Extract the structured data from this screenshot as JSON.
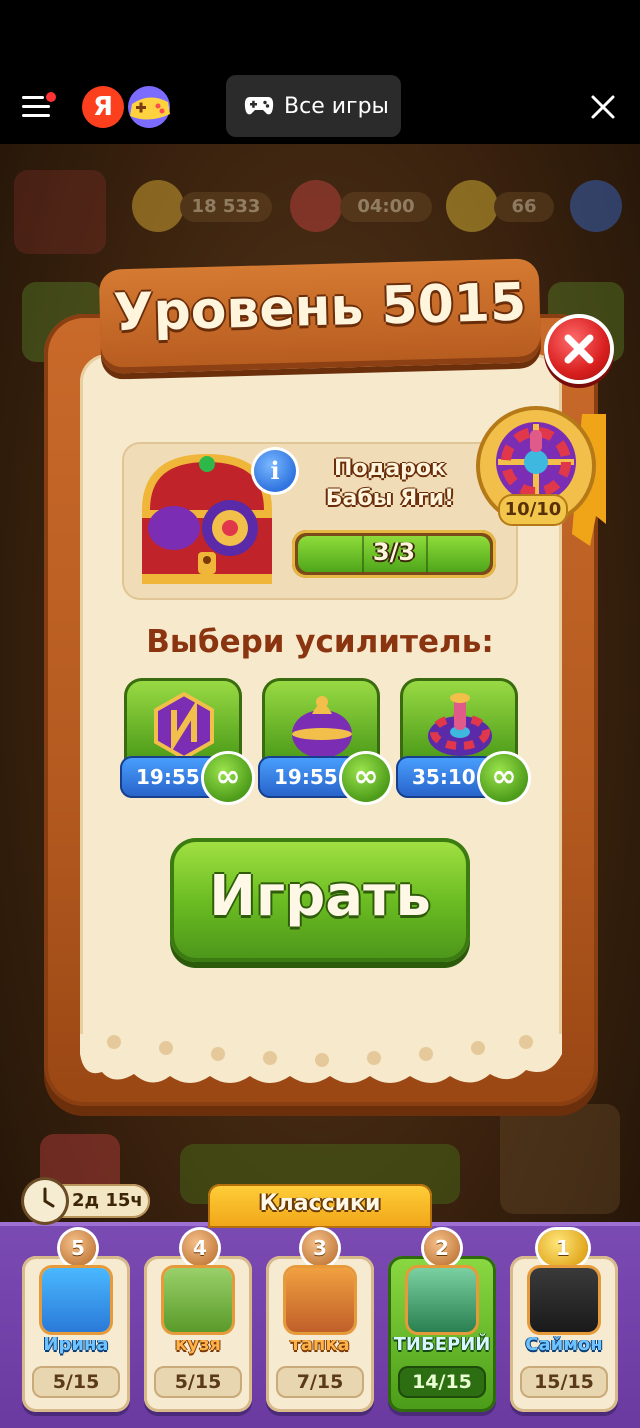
{
  "topbar": {
    "ya_letter": "Я",
    "all_games_label": "Все игры"
  },
  "hud": {
    "coins": "18 533",
    "lives_timer": "04:00",
    "stars": "66"
  },
  "dialog": {
    "title": "Уровень 5015",
    "gift_title_line1": "Подарок",
    "gift_title_line2": "Бабы Яги!",
    "gift_progress_text": "3/3",
    "gift_progress_fraction": 1.0,
    "gift_progress_segments": 3,
    "wheel_count": "10/10",
    "boosters_title": "Выбери усилитель:",
    "boosters": [
      {
        "name": "magnet-booster",
        "timer": "19:55",
        "infinite": "∞"
      },
      {
        "name": "bomb-booster",
        "timer": "19:55",
        "infinite": "∞"
      },
      {
        "name": "spinning-top-booster",
        "timer": "35:10",
        "infinite": "∞"
      }
    ],
    "play_label": "Играть"
  },
  "tournament": {
    "time_left": "2д 15ч",
    "tab_label": "Классики",
    "players": [
      {
        "rank": "5",
        "name": "Ирина",
        "score": "5/15",
        "active": false
      },
      {
        "rank": "4",
        "name": "кузя",
        "score": "5/15",
        "active": false
      },
      {
        "rank": "3",
        "name": "тапка",
        "score": "7/15",
        "active": false
      },
      {
        "rank": "2",
        "name": "ТИБЕРИЙ",
        "score": "14/15",
        "active": true
      },
      {
        "rank": "1",
        "name": "Саймон",
        "score": "15/15",
        "active": false
      }
    ]
  },
  "colors": {
    "wood": "#b45a20",
    "parchment": "#f7e9cc",
    "play_green": "#6cbd23",
    "bottom_purple": "#6a3aa0"
  }
}
